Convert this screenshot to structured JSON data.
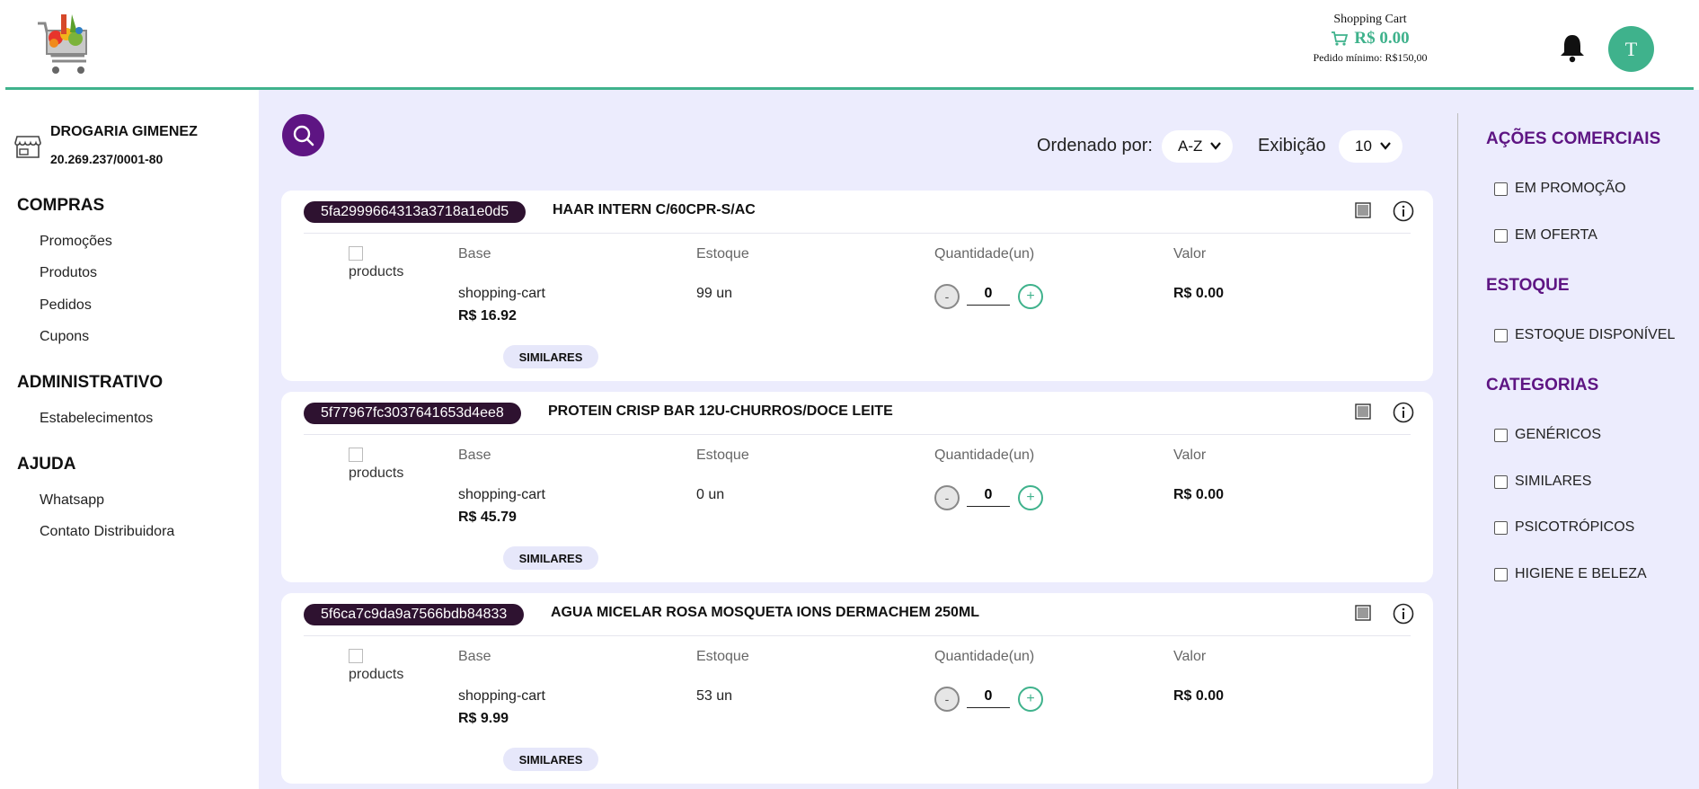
{
  "header": {
    "cart_title": "Shopping Cart",
    "cart_total": "R$ 0.00",
    "min_order": "Pedido mínimo: R$150,00",
    "avatar_initial": "T",
    "accent_color": "#3fb28c"
  },
  "sidebar": {
    "store_name": "DROGARIA GIMENEZ",
    "store_cnpj": "20.269.237/0001-80",
    "sections": [
      {
        "title": "COMPRAS",
        "items": [
          "Promoções",
          "Produtos",
          "Pedidos",
          "Cupons"
        ]
      },
      {
        "title": "ADMINISTRATIVO",
        "items": [
          "Estabelecimentos"
        ]
      },
      {
        "title": "AJUDA",
        "items": [
          "Whatsapp",
          "Contato Distribuidora"
        ]
      }
    ]
  },
  "toolbar": {
    "order_label": "Ordenado por:",
    "order_value": "A-Z",
    "display_label": "Exibição",
    "display_value": "10"
  },
  "columns": {
    "base": "Base",
    "stock": "Estoque",
    "quantity": "Quantidade(un)",
    "value": "Valor"
  },
  "products": [
    {
      "id": "5fa2999664313a3718a1e0d5",
      "name": "HAAR INTERN C/60CPR-S/AC",
      "image_alt": "products",
      "base": "shopping-cart",
      "price": "R$ 16.92",
      "stock": "99 un",
      "quantity": "0",
      "value": "R$ 0.00",
      "similar_label": "SIMILARES"
    },
    {
      "id": "5f77967fc3037641653d4ee8",
      "name": "PROTEIN CRISP BAR 12U-CHURROS/DOCE LEITE",
      "image_alt": "products",
      "base": "shopping-cart",
      "price": "R$ 45.79",
      "stock": "0 un",
      "quantity": "0",
      "value": "R$ 0.00",
      "similar_label": "SIMILARES"
    },
    {
      "id": "5f6ca7c9da9a7566bdb84833",
      "name": "AGUA MICELAR ROSA MOSQUETA IONS DERMACHEM 250ML",
      "image_alt": "products",
      "base": "shopping-cart",
      "price": "R$ 9.99",
      "stock": "53 un",
      "quantity": "0",
      "value": "R$ 0.00",
      "similar_label": "SIMILARES"
    }
  ],
  "filters": {
    "sections": [
      {
        "title": "AÇÕES COMERCIAIS",
        "items": [
          "EM PROMOÇÃO",
          "EM OFERTA"
        ]
      },
      {
        "title": "ESTOQUE",
        "items": [
          "ESTOQUE DISPONÍVEL"
        ]
      },
      {
        "title": "CATEGORIAS",
        "items": [
          "GENÉRICOS",
          "SIMILARES",
          "PSICOTRÓPICOS",
          "HIGIENE E BELEZA"
        ]
      }
    ],
    "heading_color": "#5e1583"
  }
}
